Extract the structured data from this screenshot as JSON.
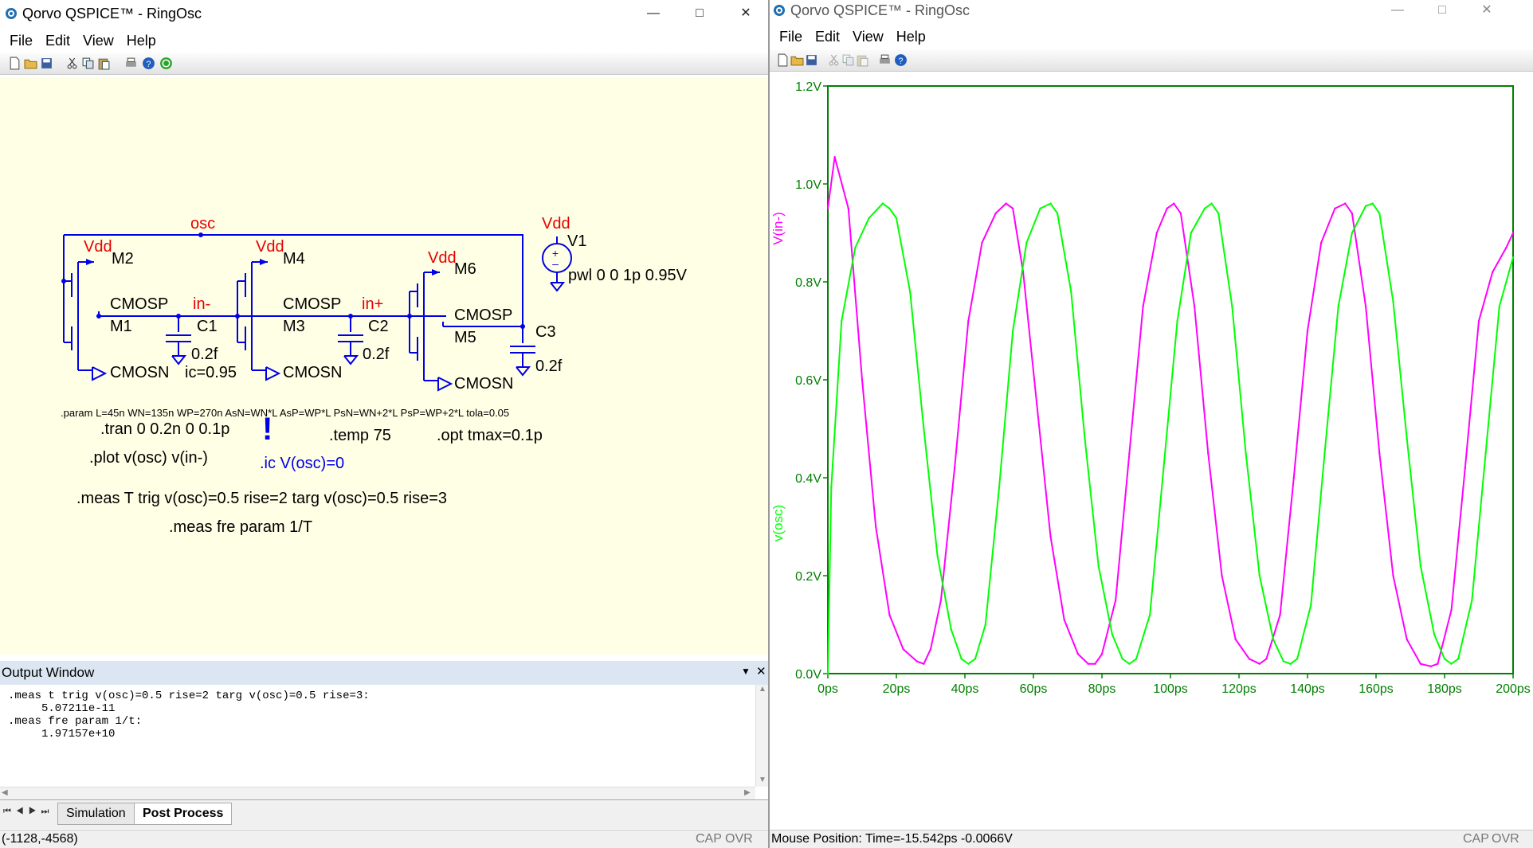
{
  "left_window": {
    "title": "Qorvo QSPICE™ - RingOsc",
    "menu": [
      "File",
      "Edit",
      "View",
      "Help"
    ],
    "schematic": {
      "net_osc": "osc",
      "vdd_label": "Vdd",
      "net_in_minus": "in-",
      "net_in_plus": "in+",
      "m1": "M1",
      "m2": "M2",
      "m3": "M3",
      "m4": "M4",
      "m5": "M5",
      "m6": "M6",
      "cmosp": "CMOSP",
      "cmosn": "CMOSN",
      "c1": "C1",
      "c2": "C2",
      "c3": "C3",
      "cap_value": "0.2f",
      "ic_value": "ic=0.95",
      "v1": "V1",
      "v1_value": "pwl 0 0 1p 0.95V",
      "param_line": ".param L=45n WN=135n WP=270n AsN=WN*L AsP=WP*L PsN=WN+2*L PsP=WP+2*L tola=0.05",
      "tran": ".tran 0 0.2n 0 0.1p",
      "temp": ".temp 75",
      "opt": ".opt  tmax=0.1p",
      "plot": ".plot v(osc) v(in-)",
      "ic": ".ic V(osc)=0",
      "meas1": ".meas T trig v(osc)=0.5 rise=2 targ v(osc)=0.5 rise=3",
      "meas2": ".meas fre param 1/T",
      "colors": {
        "wire": "#0000e6",
        "net_label": "#e60000",
        "directive": "#000000",
        "ic_directive": "#0000e6",
        "background": "#ffffe6"
      }
    },
    "output_window": {
      "title": "Output Window",
      "lines": [
        ".meas t trig v(osc)=0.5 rise=2 targ v(osc)=0.5 rise=3:",
        "     5.07211e-11",
        ".meas fre param 1/t:",
        "     1.97157e+10"
      ]
    },
    "tabs": [
      "Simulation",
      "Post Process"
    ],
    "active_tab": "Post Process",
    "status": {
      "coords": "(-1128,-4568)",
      "cap": "CAP",
      "ovr": "OVR"
    }
  },
  "right_window": {
    "title": "Qorvo QSPICE™ - RingOsc",
    "menu": [
      "File",
      "Edit",
      "View",
      "Help"
    ],
    "status": {
      "mouse": "Mouse Position: Time=-15.542ps  -0.0066V",
      "cap": "CAP",
      "ovr": "OVR"
    }
  },
  "chart_data": {
    "type": "line",
    "x_unit": "ps",
    "xlim": [
      0,
      200
    ],
    "ylim": [
      0,
      1.2
    ],
    "x_ticks": [
      "0ps",
      "20ps",
      "40ps",
      "60ps",
      "80ps",
      "100ps",
      "120ps",
      "140ps",
      "160ps",
      "180ps",
      "200ps"
    ],
    "y_ticks": [
      "0.0V",
      "0.2V",
      "0.4V",
      "0.6V",
      "0.8V",
      "1.0V",
      "1.2V"
    ],
    "grid": false,
    "axis_color": "#008000",
    "series": [
      {
        "name": "V(in-)",
        "color": "#ff00ff",
        "points": [
          [
            0,
            0.95
          ],
          [
            2,
            1.055
          ],
          [
            6,
            0.95
          ],
          [
            10,
            0.6
          ],
          [
            14,
            0.3
          ],
          [
            18,
            0.12
          ],
          [
            22,
            0.05
          ],
          [
            26,
            0.025
          ],
          [
            28,
            0.02
          ],
          [
            30,
            0.05
          ],
          [
            33,
            0.15
          ],
          [
            37,
            0.42
          ],
          [
            41,
            0.72
          ],
          [
            45,
            0.88
          ],
          [
            49,
            0.94
          ],
          [
            52,
            0.96
          ],
          [
            54,
            0.95
          ],
          [
            57,
            0.82
          ],
          [
            61,
            0.55
          ],
          [
            65,
            0.28
          ],
          [
            69,
            0.11
          ],
          [
            73,
            0.04
          ],
          [
            76,
            0.02
          ],
          [
            78,
            0.02
          ],
          [
            80,
            0.04
          ],
          [
            84,
            0.15
          ],
          [
            88,
            0.45
          ],
          [
            92,
            0.75
          ],
          [
            96,
            0.9
          ],
          [
            99,
            0.95
          ],
          [
            101,
            0.96
          ],
          [
            103,
            0.94
          ],
          [
            107,
            0.75
          ],
          [
            111,
            0.45
          ],
          [
            115,
            0.2
          ],
          [
            119,
            0.07
          ],
          [
            123,
            0.03
          ],
          [
            126,
            0.02
          ],
          [
            128,
            0.03
          ],
          [
            132,
            0.12
          ],
          [
            136,
            0.4
          ],
          [
            140,
            0.7
          ],
          [
            144,
            0.88
          ],
          [
            148,
            0.95
          ],
          [
            151,
            0.96
          ],
          [
            153,
            0.94
          ],
          [
            157,
            0.75
          ],
          [
            161,
            0.45
          ],
          [
            165,
            0.2
          ],
          [
            169,
            0.07
          ],
          [
            173,
            0.02
          ],
          [
            176,
            0.015
          ],
          [
            178,
            0.02
          ],
          [
            182,
            0.13
          ],
          [
            186,
            0.42
          ],
          [
            190,
            0.72
          ],
          [
            194,
            0.82
          ],
          [
            198,
            0.87
          ],
          [
            200,
            0.9
          ]
        ]
      },
      {
        "name": "v(osc)",
        "color": "#00ff00",
        "points": [
          [
            0,
            0.0
          ],
          [
            1,
            0.38
          ],
          [
            4,
            0.72
          ],
          [
            8,
            0.87
          ],
          [
            12,
            0.93
          ],
          [
            16,
            0.96
          ],
          [
            18,
            0.95
          ],
          [
            20,
            0.93
          ],
          [
            24,
            0.78
          ],
          [
            28,
            0.5
          ],
          [
            32,
            0.24
          ],
          [
            36,
            0.09
          ],
          [
            39,
            0.03
          ],
          [
            41,
            0.02
          ],
          [
            43,
            0.03
          ],
          [
            46,
            0.1
          ],
          [
            50,
            0.38
          ],
          [
            54,
            0.7
          ],
          [
            58,
            0.88
          ],
          [
            62,
            0.95
          ],
          [
            65,
            0.96
          ],
          [
            67,
            0.94
          ],
          [
            71,
            0.78
          ],
          [
            75,
            0.48
          ],
          [
            79,
            0.22
          ],
          [
            83,
            0.08
          ],
          [
            86,
            0.03
          ],
          [
            88,
            0.02
          ],
          [
            90,
            0.03
          ],
          [
            94,
            0.12
          ],
          [
            98,
            0.42
          ],
          [
            102,
            0.72
          ],
          [
            106,
            0.9
          ],
          [
            110,
            0.95
          ],
          [
            112,
            0.96
          ],
          [
            114,
            0.94
          ],
          [
            118,
            0.75
          ],
          [
            122,
            0.45
          ],
          [
            126,
            0.2
          ],
          [
            130,
            0.07
          ],
          [
            133,
            0.025
          ],
          [
            135,
            0.02
          ],
          [
            137,
            0.03
          ],
          [
            141,
            0.14
          ],
          [
            145,
            0.45
          ],
          [
            149,
            0.75
          ],
          [
            153,
            0.9
          ],
          [
            157,
            0.955
          ],
          [
            159,
            0.96
          ],
          [
            161,
            0.94
          ],
          [
            165,
            0.76
          ],
          [
            169,
            0.48
          ],
          [
            173,
            0.22
          ],
          [
            177,
            0.08
          ],
          [
            180,
            0.03
          ],
          [
            182,
            0.02
          ],
          [
            184,
            0.03
          ],
          [
            188,
            0.15
          ],
          [
            192,
            0.45
          ],
          [
            196,
            0.75
          ],
          [
            200,
            0.85
          ]
        ]
      }
    ]
  }
}
